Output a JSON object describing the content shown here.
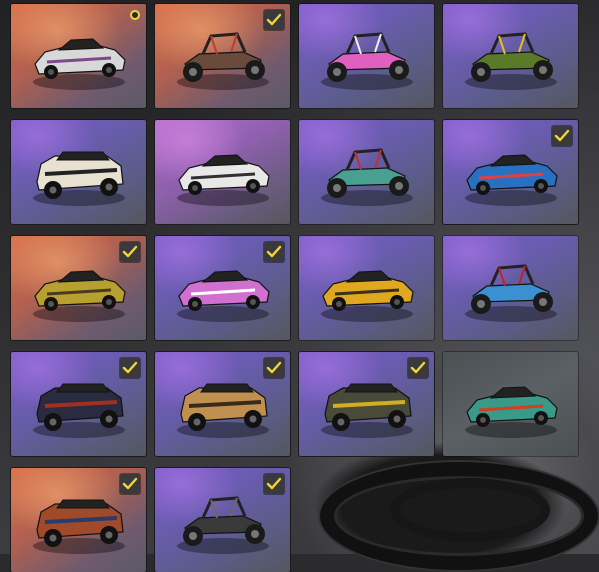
{
  "accent_color": "#f3d43a",
  "tiles": [
    {
      "name": "muscle-car-white",
      "style": "orange",
      "badge": "new",
      "body": "#d8d8d8",
      "trim": "#7a4a8a",
      "kind": "sedan"
    },
    {
      "name": "buggy-rusty",
      "style": "orange",
      "badge": "check",
      "body": "#6a4a3a",
      "trim": "#b84030",
      "kind": "buggy"
    },
    {
      "name": "buggy-pink",
      "style": "purple",
      "badge": "none",
      "body": "#e060c0",
      "trim": "#eeeeee",
      "kind": "buggy"
    },
    {
      "name": "buggy-camo",
      "style": "purple",
      "badge": "none",
      "body": "#5a7a2a",
      "trim": "#e0c020",
      "kind": "buggy"
    },
    {
      "name": "suv-leopard",
      "style": "purple",
      "badge": "none",
      "body": "#e8e0d0",
      "trim": "#222222",
      "kind": "suv"
    },
    {
      "name": "sedan-white-black",
      "style": "pink",
      "badge": "none",
      "body": "#e8e8e8",
      "trim": "#303030",
      "kind": "sedan"
    },
    {
      "name": "buggy-teal",
      "style": "purple",
      "badge": "none",
      "body": "#4aa090",
      "trim": "#c03030",
      "kind": "buggy"
    },
    {
      "name": "sedan-blue-cartoon",
      "style": "purple",
      "badge": "check",
      "body": "#2a70c0",
      "trim": "#e04040",
      "kind": "sedan"
    },
    {
      "name": "sedan-yellow-rust",
      "style": "orange",
      "badge": "check",
      "body": "#b8a030",
      "trim": "#4a3a20",
      "kind": "sedan"
    },
    {
      "name": "muscle-car-pink",
      "style": "purple",
      "badge": "check",
      "body": "#d070d0",
      "trim": "#ffffff",
      "kind": "sedan"
    },
    {
      "name": "taxi-yellow",
      "style": "purple",
      "badge": "none",
      "body": "#e0a820",
      "trim": "#3a3020",
      "kind": "sedan"
    },
    {
      "name": "buggy-blue",
      "style": "purple",
      "badge": "none",
      "body": "#3a90d0",
      "trim": "#c02030",
      "kind": "buggy"
    },
    {
      "name": "suv-dark-red",
      "style": "purple",
      "badge": "check",
      "body": "#2a2a40",
      "trim": "#a03020",
      "kind": "suv"
    },
    {
      "name": "pickup-tan",
      "style": "purple",
      "badge": "check",
      "body": "#c09050",
      "trim": "#3a2a1a",
      "kind": "suv"
    },
    {
      "name": "suv-olive-yellow",
      "style": "purple",
      "badge": "check",
      "body": "#4a4a3a",
      "trim": "#d0b020",
      "kind": "suv"
    },
    {
      "name": "sedan-teal-flames",
      "style": "grey",
      "badge": "none",
      "body": "#3a9a8a",
      "trim": "#d04020",
      "kind": "sedan"
    },
    {
      "name": "hatchback-rusty",
      "style": "orange",
      "badge": "check",
      "body": "#a04a2a",
      "trim": "#2a3a6a",
      "kind": "suv"
    },
    {
      "name": "rover-dark",
      "style": "purple",
      "badge": "check",
      "body": "#3a3a3a",
      "trim": "#6a6a6a",
      "kind": "buggy"
    }
  ]
}
